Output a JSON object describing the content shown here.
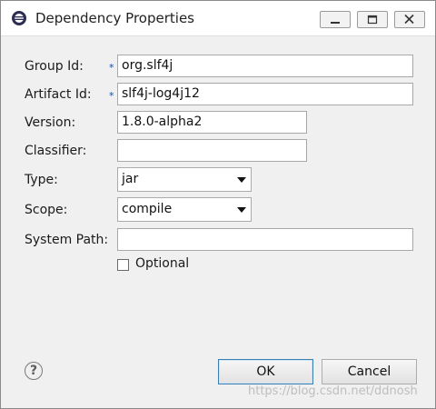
{
  "window": {
    "title": "Dependency Properties",
    "icon": "eclipse-app-icon"
  },
  "form": {
    "group_id": {
      "label": "Group Id:",
      "value": "org.slf4j",
      "required": true
    },
    "artifact_id": {
      "label": "Artifact Id:",
      "value": "slf4j-log4j12",
      "required": true
    },
    "version": {
      "label": "Version:",
      "value": "1.8.0-alpha2"
    },
    "classifier": {
      "label": "Classifier:",
      "value": ""
    },
    "type": {
      "label": "Type:",
      "value": "jar"
    },
    "scope": {
      "label": "Scope:",
      "value": "compile"
    },
    "system_path": {
      "label": "System Path:",
      "value": ""
    },
    "optional": {
      "label": "Optional",
      "checked": false
    },
    "required_marker": "*"
  },
  "buttons": {
    "help_glyph": "?",
    "ok_label": "OK",
    "cancel_label": "Cancel"
  },
  "watermark": "https://blog.csdn.net/ddnosh",
  "colors": {
    "ok_border": "#3c7fb1",
    "required_marker": "#1a4f9c"
  }
}
